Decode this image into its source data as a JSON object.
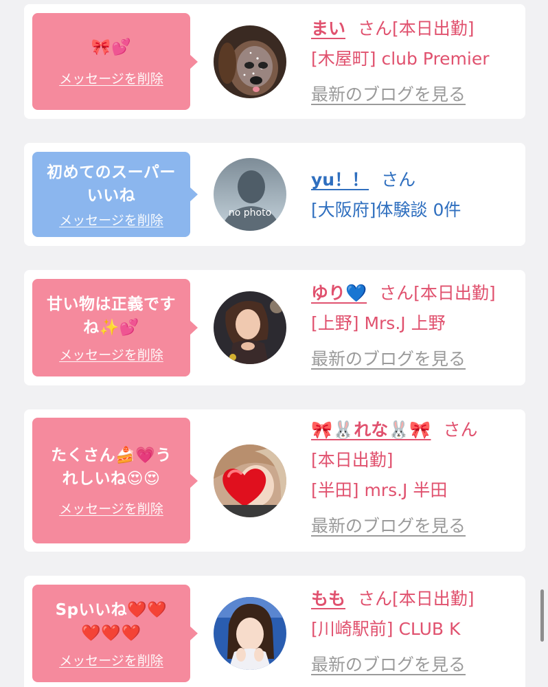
{
  "delete_label": "メッセージを削除",
  "blog_label": "最新のブログを見る",
  "san": "さん",
  "colors": {
    "background": "#f1f1f3",
    "card": "#ffffff",
    "bubble_pink": "#f58a9d",
    "bubble_blue": "#8bb6ee",
    "name_pink": "#e0516e",
    "name_blue": "#2f6fbf",
    "link_gray": "#9a9a9a"
  },
  "items": [
    {
      "message": "🎀💕",
      "name": "まい",
      "status": "[本日出勤]",
      "shop": "[木屋町] club Premier",
      "bubble_color": "pink",
      "avatar_icon": "dog-filter-photo-icon"
    },
    {
      "message": "初めてのスーパーいいね",
      "name": "yu！！",
      "detail": "[大阪府]体験談 0件",
      "no_photo": "no photo",
      "bubble_color": "blue",
      "avatar_icon": "no-photo-silhouette-icon"
    },
    {
      "message": "甘い物は正義ですね✨💕",
      "name": "ゆり💙",
      "status": "[本日出勤]",
      "shop": "[上野] Mrs.J 上野",
      "bubble_color": "pink",
      "avatar_icon": "woman-photo-icon"
    },
    {
      "message": "たくさん🍰💗うれしいね😍😍",
      "name": "🎀🐰れな🐰🎀",
      "status": "[本日出勤]",
      "shop": "[半田] mrs.J 半田",
      "bubble_color": "pink",
      "avatar_icon": "heart-covered-photo-icon"
    },
    {
      "message": "Spいいね❤️❤️❤️❤️❤️",
      "name": "もも",
      "status": "[本日出勤]",
      "shop": "[川崎駅前] CLUB K",
      "bubble_color": "pink",
      "avatar_icon": "woman-portrait-photo-icon"
    }
  ]
}
